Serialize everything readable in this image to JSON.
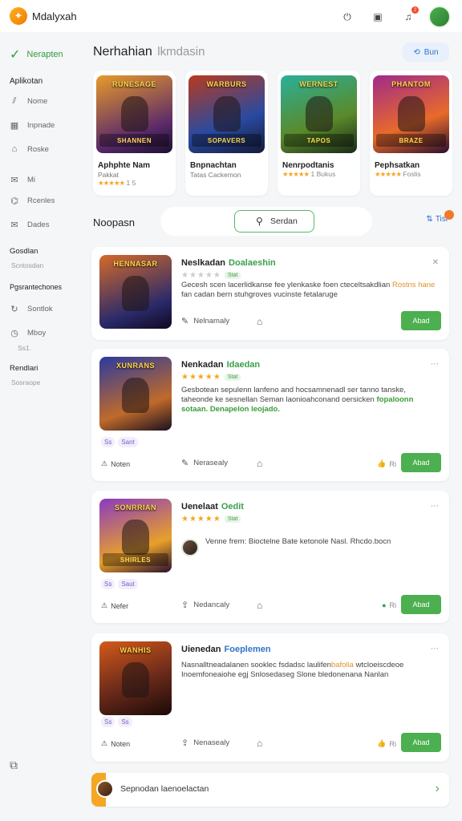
{
  "app": {
    "name": "Mdalyxah"
  },
  "topbar": {
    "icons": [
      "power-icon",
      "battery-icon",
      "bell-icon"
    ],
    "notification_badge": "2"
  },
  "sidebar": {
    "active": {
      "label": "Nerapten",
      "icon": "check-icon"
    },
    "section1": "Aplikotan",
    "items1": [
      {
        "label": "Nome",
        "icon": "chart-icon"
      },
      {
        "label": "Inpnade",
        "icon": "grid-icon"
      },
      {
        "label": "Roske",
        "icon": "home-icon"
      },
      {
        "label": "Mi",
        "icon": "mail-icon"
      },
      {
        "label": "Rcenles",
        "icon": "tag-icon"
      },
      {
        "label": "Dades",
        "icon": "envelope-icon"
      }
    ],
    "section2": "Gosdlan",
    "section2_sub": "Scntosdan",
    "section3": "Pgsrantechones",
    "items2": [
      {
        "label": "Sontlok",
        "icon": "refresh-icon"
      },
      {
        "label": "Mboy",
        "icon": "clock-icon"
      }
    ],
    "items2_sub": "Ss1.",
    "section4": "Rendlari",
    "section4_sub": "Sosraope"
  },
  "main": {
    "section_title": "Nerhahian",
    "section_title_light": "lkmdasin",
    "top_button": "Bun",
    "featured": [
      {
        "title": "Aphphte Nam",
        "sub": "Pakkat",
        "rating_text": "1 5",
        "art_top": "RUNESAGE",
        "art_label": "SHANNEN",
        "colors": [
          "#d88a24",
          "#3a2a56"
        ]
      },
      {
        "title": "Bnpnachtan",
        "sub": "Tatas Cackemon",
        "rating_text": "",
        "art_top": "WARBURS",
        "art_label": "SOPAVERS",
        "colors": [
          "#2a4aa0",
          "#a4381e"
        ]
      },
      {
        "title": "Nenrpodtanis",
        "sub": "",
        "rating_text": "1 Bukus",
        "art_top": "WERNEST",
        "art_label": "TAPOS",
        "colors": [
          "#1e8a7a",
          "#6a8a2a"
        ]
      },
      {
        "title": "Pephsatkan",
        "sub": "",
        "rating_text": "Foslis",
        "art_top": "PHANTOM",
        "art_label": "BRAZE",
        "colors": [
          "#8a2a8a",
          "#e86a2a"
        ]
      }
    ],
    "list_head": "Noopasn",
    "search": {
      "label": "Serdan"
    },
    "filter": {
      "label": "Tisi"
    },
    "cards": [
      {
        "title": "Neslkadan",
        "tag": "Doalaeshin",
        "tag_color": "#3aa04a",
        "stars": "★★★★★",
        "stars_muted": true,
        "stars_chip": "Stat",
        "desc_plain": "Gecesh scen lacerlidkanse fee ylenkaske foen cteceltsakdlian ",
        "desc_hl": "Rostns hane",
        "desc_rest": " fan cadan bern stuhgroves vucinste fetalaruge",
        "meta": "Nelnamaly",
        "art_top": "HENNASAR",
        "art_label": "",
        "colors": [
          "#c45a2a",
          "#2a2a6a"
        ],
        "button": "Abad"
      },
      {
        "title": "Nenkadan",
        "tag": "Idaedan",
        "tag_color": "#3aa04a",
        "stars": "★★★★★",
        "stars_muted": false,
        "stars_chip": "Stat",
        "desc_plain": "Gesbotean sepulenn lanfeno and hocsamnenadl ser tanno tanske, taheonde ke sesnellan Seman laonioahconand oersicken ",
        "desc_hl": "fopaloonn sotaan. Denapelon leojado.",
        "desc_rest": "",
        "meta": "Nerasealy",
        "chips": [
          "Ss",
          "Sant"
        ],
        "bottom_left": "Noten",
        "likes": "Ri",
        "art_top": "XUNRANS",
        "art_label": "",
        "colors": [
          "#3a4aa0",
          "#c06a2a"
        ],
        "button": "Abad"
      },
      {
        "title": "Uenelaat",
        "tag": "Oedit",
        "tag_color": "#3aa04a",
        "stars": "★★★★★",
        "stars_muted": false,
        "stars_chip": "Stat",
        "desc_plain": "Venne frem: Bioctelne Bate ketonole Nasl.",
        "desc_hl": "",
        "desc_rest": " Rhcdo.bocn",
        "meta": "Nedancaly",
        "chips": [
          "Ss",
          "Saut"
        ],
        "bottom_left": "Nefer",
        "likes": "Ri",
        "art_top": "SONRRIAN",
        "art_label": "SHIRLES",
        "colors": [
          "#8a3ac0",
          "#e8a02a"
        ],
        "button": "Abad"
      },
      {
        "title": "Uienedan",
        "tag": "Foeplemen",
        "tag_color": "#2f74c9",
        "stars": "",
        "stars_muted": false,
        "stars_chip": "",
        "desc_plain": "Nasnalltneadalanen sooklec fsdadsc laulifen",
        "desc_hl": "bafolia",
        "desc_rest": " wtcloeiscdeoe Inoemfoneaiohe egj Snlosedaseg Slone bledonenana Nanlan",
        "meta": "Nenasealy",
        "chips": [
          "Ss",
          "Ss"
        ],
        "bottom_left": "Noten",
        "likes": "Ri",
        "art_top": "WANHIS",
        "art_label": "",
        "colors": [
          "#c04a1a",
          "#2a1a10"
        ],
        "button": "Abad"
      }
    ],
    "bottom": {
      "text": "Sepnodan laenoelactan"
    }
  }
}
